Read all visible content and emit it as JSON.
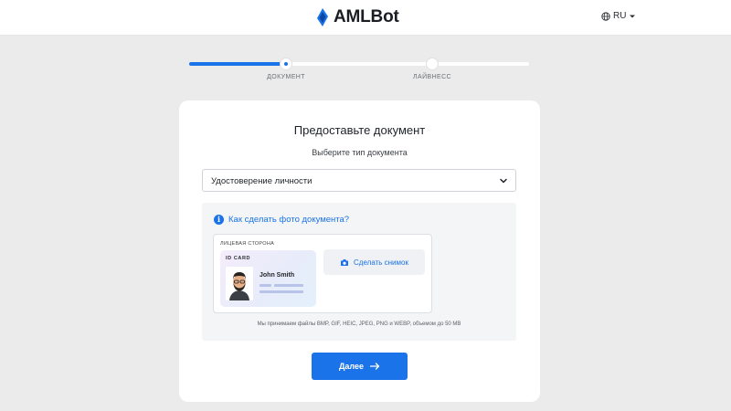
{
  "header": {
    "logo_text": "AMLBot",
    "language": "RU",
    "language_icon": "globe-icon",
    "dropdown_icon": "caret-down-icon"
  },
  "progress": {
    "steps": [
      {
        "label": "ДОКУМЕНТ",
        "state": "current"
      },
      {
        "label": "ЛАЙВНЕСС",
        "state": "upcoming"
      }
    ],
    "completed_fraction": 0.28
  },
  "card": {
    "title": "Предоставьте документ",
    "subtitle": "Выберите тип документа",
    "document_type": {
      "selected": "Удостоверение личности",
      "icon": "chevron-down-icon"
    },
    "help_link": {
      "icon": "info-icon",
      "text": "Как сделать фото документа?"
    },
    "upload": {
      "side_label": "ЛИЦЕВАЯ СТОРОНА",
      "sample_card": {
        "title": "ID CARD",
        "name": "John Smith",
        "photo_icon": "avatar-illustration"
      },
      "snapshot_button": {
        "icon": "camera-icon",
        "label": "Сделать снимок"
      },
      "formats_note": "Мы принимаем файлы BMP, GIF, HEIC, JPEG, PNG и WEBP, объемом до 50 MB"
    },
    "next_button": {
      "label": "Далее",
      "icon": "arrow-right-icon"
    }
  },
  "colors": {
    "accent": "#1a73e8",
    "page_background": "#ebebeb",
    "panel_background": "#f4f5f6"
  }
}
